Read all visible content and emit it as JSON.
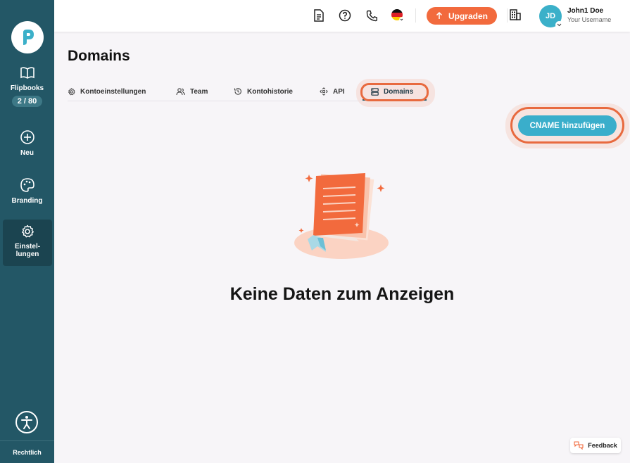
{
  "sidebar": {
    "flipbooks_label": "Flipbooks",
    "flipbooks_count": "2 / 80",
    "new_label": "Neu",
    "branding_label": "Branding",
    "settings_label_line1": "Einstel-",
    "settings_label_line2": "lungen",
    "legal_label": "Rechtlich"
  },
  "topbar": {
    "upgrade_label": "Upgraden",
    "user_name": "John1 Doe",
    "user_username": "Your Username",
    "avatar_initials": "JD"
  },
  "page": {
    "title": "Domains",
    "tabs": [
      {
        "label": "Kontoeinstellungen",
        "icon": "gear-icon"
      },
      {
        "label": "Team",
        "icon": "users-icon"
      },
      {
        "label": "Kontohistorie",
        "icon": "history-icon"
      },
      {
        "label": "API",
        "icon": "api-icon"
      },
      {
        "label": "Domains",
        "icon": "server-icon",
        "active": true
      }
    ],
    "cname_button_label": "CNAME hinzufügen",
    "empty_state_text": "Keine Daten zum Anzeigen"
  },
  "feedback_label": "Feedback",
  "colors": {
    "sidebar_bg": "#235766",
    "accent_orange": "#f26a3d",
    "cname_blue": "#3aaecb",
    "page_bg": "#f7f5f8"
  }
}
